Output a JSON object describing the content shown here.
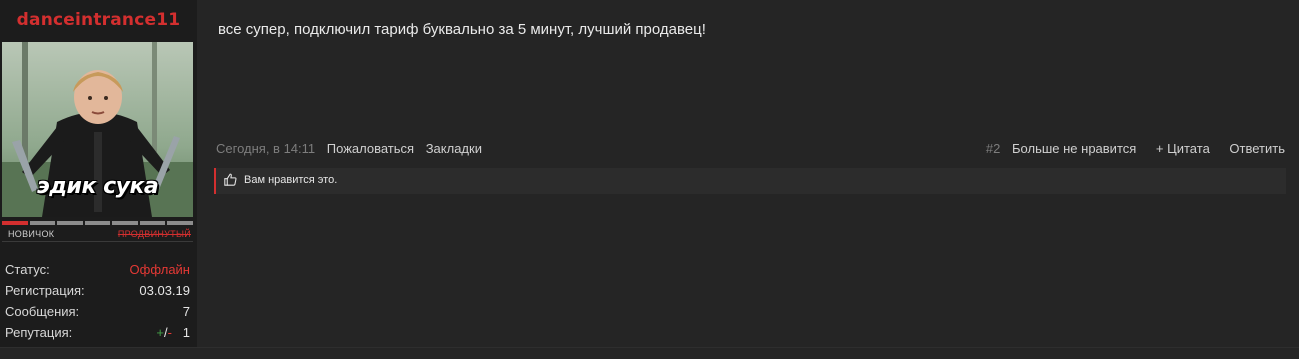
{
  "user": {
    "username": "danceintrance11",
    "avatar_caption": "эдик сука",
    "rank_current": "Новичок",
    "rank_next": "Продвинутый",
    "rank_progress_segments": 7,
    "rank_filled_segments": 1
  },
  "stats": {
    "status_label": "Статус:",
    "status_value": "Оффлайн",
    "registration_label": "Регистрация:",
    "registration_value": "03.03.19",
    "messages_label": "Сообщения:",
    "messages_value": "7",
    "reputation_label": "Репутация:",
    "reputation_plus": "+",
    "reputation_sep": "/",
    "reputation_minus": "-",
    "reputation_value": "1"
  },
  "post": {
    "text": "все супер, подключил тариф буквально за 5 минут, лучший продавец!",
    "date": "Сегодня, в 14:11",
    "report_label": "Пожаловаться",
    "bookmarks_label": "Закладки",
    "post_number": "#2",
    "unlike_label": "Больше не нравится",
    "quote_label": "+ Цитата",
    "reply_label": "Ответить",
    "likes_text": "Вам нравится это."
  },
  "colors": {
    "accent": "#d32f2f",
    "background": "#252525",
    "sidebar": "#1c1c1c"
  }
}
